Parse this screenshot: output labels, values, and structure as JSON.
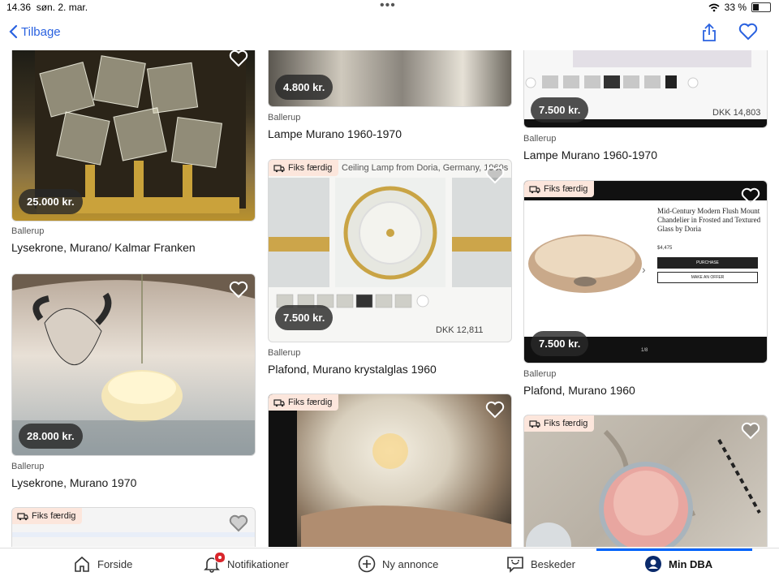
{
  "status": {
    "time": "14.36",
    "date": "søn. 2. mar.",
    "battery": "33 %"
  },
  "nav": {
    "back_label": "Tilbage",
    "share_icon": "share-icon",
    "favorite_icon": "heart-icon"
  },
  "accent": "#2a62e0",
  "listings": [
    {
      "price": "25.000 kr.",
      "location": "Ballerup",
      "title": "Lysekrone, Murano/ Kalmar Franken",
      "fiks": false
    },
    {
      "price": "4.800 kr.",
      "location": "Ballerup",
      "title": "Lampe Murano 1960-1970",
      "fiks": false
    },
    {
      "price": "7.500 kr.",
      "location": "Ballerup",
      "title": "Lampe Murano 1960-1970",
      "fiks": false,
      "overlay_text": "DKK 14,803"
    },
    {
      "price": "28.000 kr.",
      "location": "Ballerup",
      "title": "Lysekrone, Murano 1970",
      "fiks": false
    },
    {
      "price": "7.500 kr.",
      "location": "Ballerup",
      "title": "Plafond, Murano krystalglas 1960",
      "fiks": true,
      "overlay_text": "DKK 12,811",
      "image_caption": "Ceiling Lamp from Doria, Germany, 1960s"
    },
    {
      "price": "7.500 kr.",
      "location": "Ballerup",
      "title": "Plafond, Murano 1960",
      "fiks": true,
      "screenshot_title": "Mid-Century Modern Flush Mount Chandelier in Frosted and Textured Glass by Doria",
      "screenshot_price": "$4,475",
      "purchase": "PURCHASE",
      "offer": "MAKE AN OFFER",
      "pager": "1/8"
    },
    {
      "price": "",
      "location": "",
      "title": "",
      "fiks": true
    },
    {
      "price": "",
      "location": "",
      "title": "",
      "fiks": true
    },
    {
      "price": "",
      "location": "",
      "title": "",
      "fiks": true
    }
  ],
  "fiks_label": "Fiks færdig",
  "tabs": [
    {
      "label": "Forside",
      "icon": "home-icon"
    },
    {
      "label": "Notifikationer",
      "icon": "bell-icon"
    },
    {
      "label": "Ny annonce",
      "icon": "plus-circle-icon"
    },
    {
      "label": "Beskeder",
      "icon": "chat-icon"
    },
    {
      "label": "Min DBA",
      "icon": "profile-icon"
    }
  ]
}
